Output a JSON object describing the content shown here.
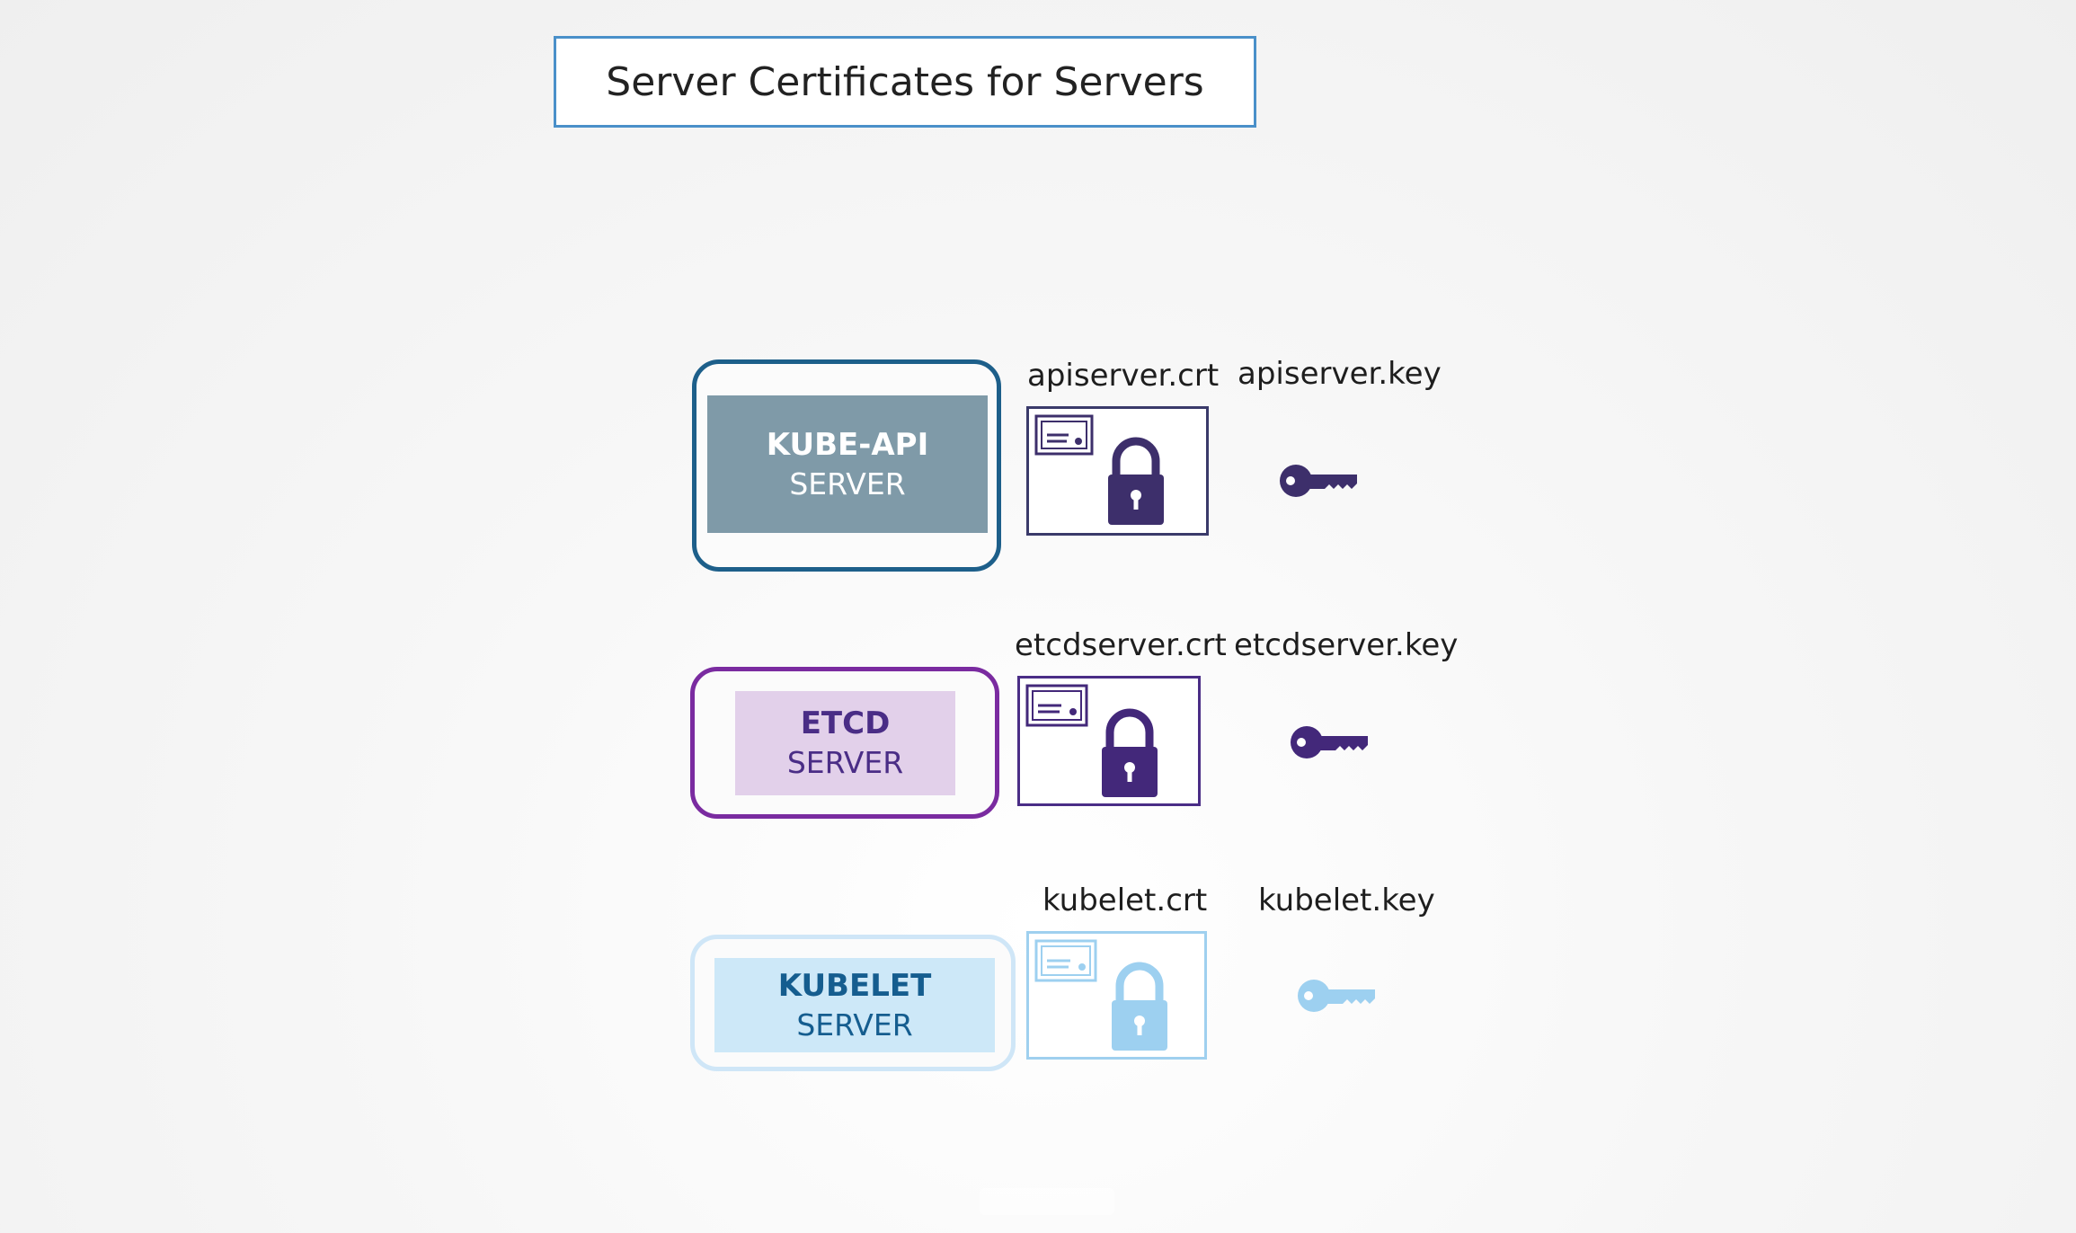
{
  "title": "Server Certificates for Servers",
  "servers": [
    {
      "name": "KUBE-API",
      "subtitle": "SERVER",
      "cert_file": "apiserver.crt",
      "key_file": "apiserver.key",
      "colors": {
        "outer_border": "#1d5f8a",
        "inner_fill": "#7f9aa8",
        "text": "#ffffff",
        "cert_border": "#3a3a6a",
        "icon": "#3d2f6b"
      }
    },
    {
      "name": "ETCD",
      "subtitle": "SERVER",
      "cert_file": "etcdserver.crt",
      "key_file": "etcdserver.key",
      "colors": {
        "outer_border": "#7a2ba0",
        "inner_fill": "#e2d0ea",
        "text": "#4a2d86",
        "cert_border": "#4a2d86",
        "icon": "#43287a"
      }
    },
    {
      "name": "KUBELET",
      "subtitle": "SERVER",
      "cert_file": "kubelet.crt",
      "key_file": "kubelet.key",
      "colors": {
        "outer_border": "#cfe6f7",
        "inner_fill": "#cde8f8",
        "text": "#155d8f",
        "cert_border": "#9fd0ef",
        "icon": "#9dd0f0"
      }
    }
  ],
  "icons": {
    "certificate": "certificate-icon",
    "lock": "lock-icon",
    "key": "key-icon"
  }
}
